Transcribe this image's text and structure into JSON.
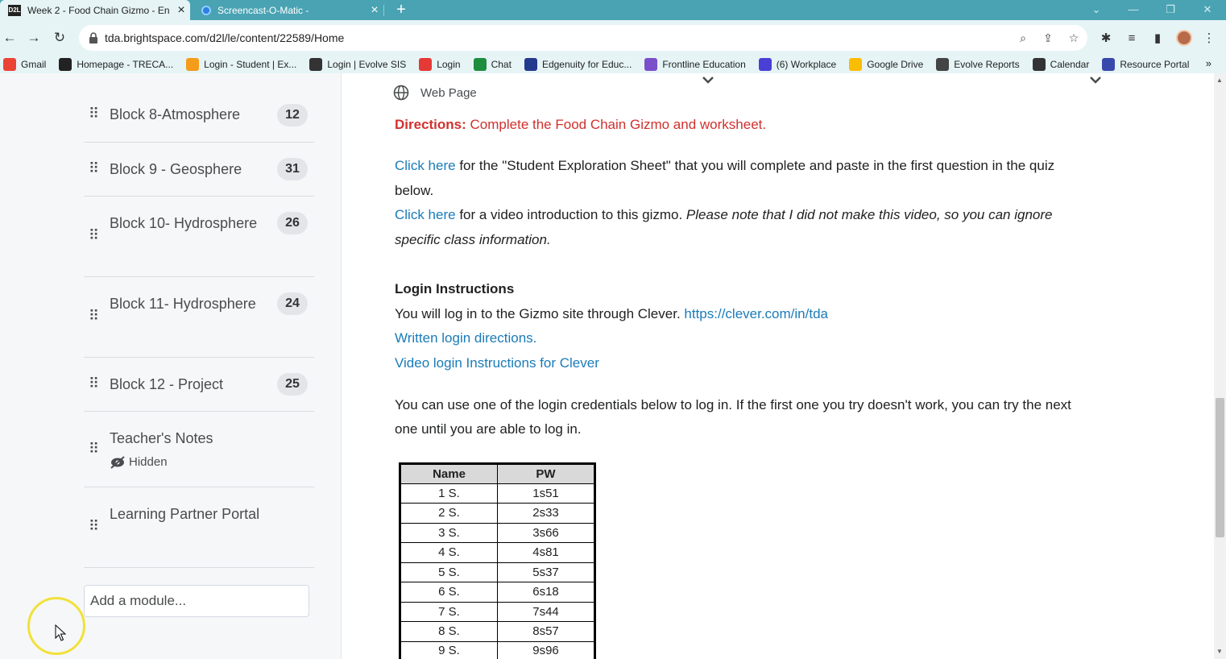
{
  "browser": {
    "tabs": [
      {
        "title": "Week 2 - Food Chain Gizmo - En",
        "favicon": "D2L",
        "close": "×"
      },
      {
        "title": "Screencast-O-Matic -",
        "close": "×"
      }
    ],
    "new_tab": "+",
    "url": "tda.brightspace.com/d2l/le/content/22589/Home",
    "bookmarks": [
      {
        "label": "Gmail",
        "color": "#ea4335"
      },
      {
        "label": "Homepage - TRECA...",
        "color": "#222222"
      },
      {
        "label": "Login - Student | Ex...",
        "color": "#f59c1a"
      },
      {
        "label": "Login | Evolve SIS",
        "color": "#333333"
      },
      {
        "label": "Login",
        "color": "#e53935"
      },
      {
        "label": "Chat",
        "color": "#1e8e3e"
      },
      {
        "label": "Edgenuity for Educ...",
        "color": "#243a8c"
      },
      {
        "label": "Frontline Education",
        "color": "#7b4fc9"
      },
      {
        "label": "(6) Workplace",
        "color": "#4b3fd6"
      },
      {
        "label": "Google Drive",
        "color": "#fbbc04"
      },
      {
        "label": "Evolve Reports",
        "color": "#444444"
      },
      {
        "label": "Calendar",
        "color": "#333333"
      },
      {
        "label": "Resource Portal",
        "color": "#3949ab"
      }
    ],
    "more": "»"
  },
  "sidebar": {
    "modules": [
      {
        "title": "Block 8-Atmosphere",
        "count": "12"
      },
      {
        "title": "Block 9 - Geosphere",
        "count": "31"
      },
      {
        "title": "Block 10- Hydrosphere",
        "count": "26"
      },
      {
        "title": "Block 11- Hydrosphere",
        "count": "24"
      },
      {
        "title": "Block 12 - Project",
        "count": "25"
      },
      {
        "title": "Teacher's Notes",
        "status": "Hidden"
      },
      {
        "title": "Learning Partner Portal"
      }
    ],
    "add_module_placeholder": "Add a module..."
  },
  "content": {
    "item_type": "Web Page",
    "directions_label": "Directions:",
    "directions_text": " Complete the Food Chain Gizmo and worksheet.",
    "line1_link": "Click here",
    "line1_text": " for the \"Student Exploration Sheet\" that you will complete and paste in the first question in the quiz",
    "line1_cont": "below.",
    "line2_link": "Click here",
    "line2_text": " for a video introduction to this gizmo. ",
    "line2_italic": "Please note that I did not make this video, so you can ignore",
    "line2_italic_cont": "specific class information.",
    "login_heading": "Login Instructions",
    "login_text": "You will log in to the Gizmo site through Clever. ",
    "login_url": "https://clever.com/in/tda",
    "written_link": "Written login directions.",
    "video_link": "Video login Instructions for Clever",
    "creds_text": "You can use one of the login credentials below to log in.  If the first one you try doesn't work, you can try the next",
    "creds_cont": "one until you are able to log in.",
    "table": {
      "headers": [
        "Name",
        "PW"
      ],
      "rows": [
        [
          "1 S.",
          "1s51"
        ],
        [
          "2 S.",
          "2s33"
        ],
        [
          "3 S.",
          "3s66"
        ],
        [
          "4 S.",
          "4s81"
        ],
        [
          "5 S.",
          "5s37"
        ],
        [
          "6 S.",
          "6s18"
        ],
        [
          "7 S.",
          "7s44"
        ],
        [
          "8 S.",
          "8s57"
        ],
        [
          "9 S.",
          "9s96"
        ]
      ]
    }
  }
}
